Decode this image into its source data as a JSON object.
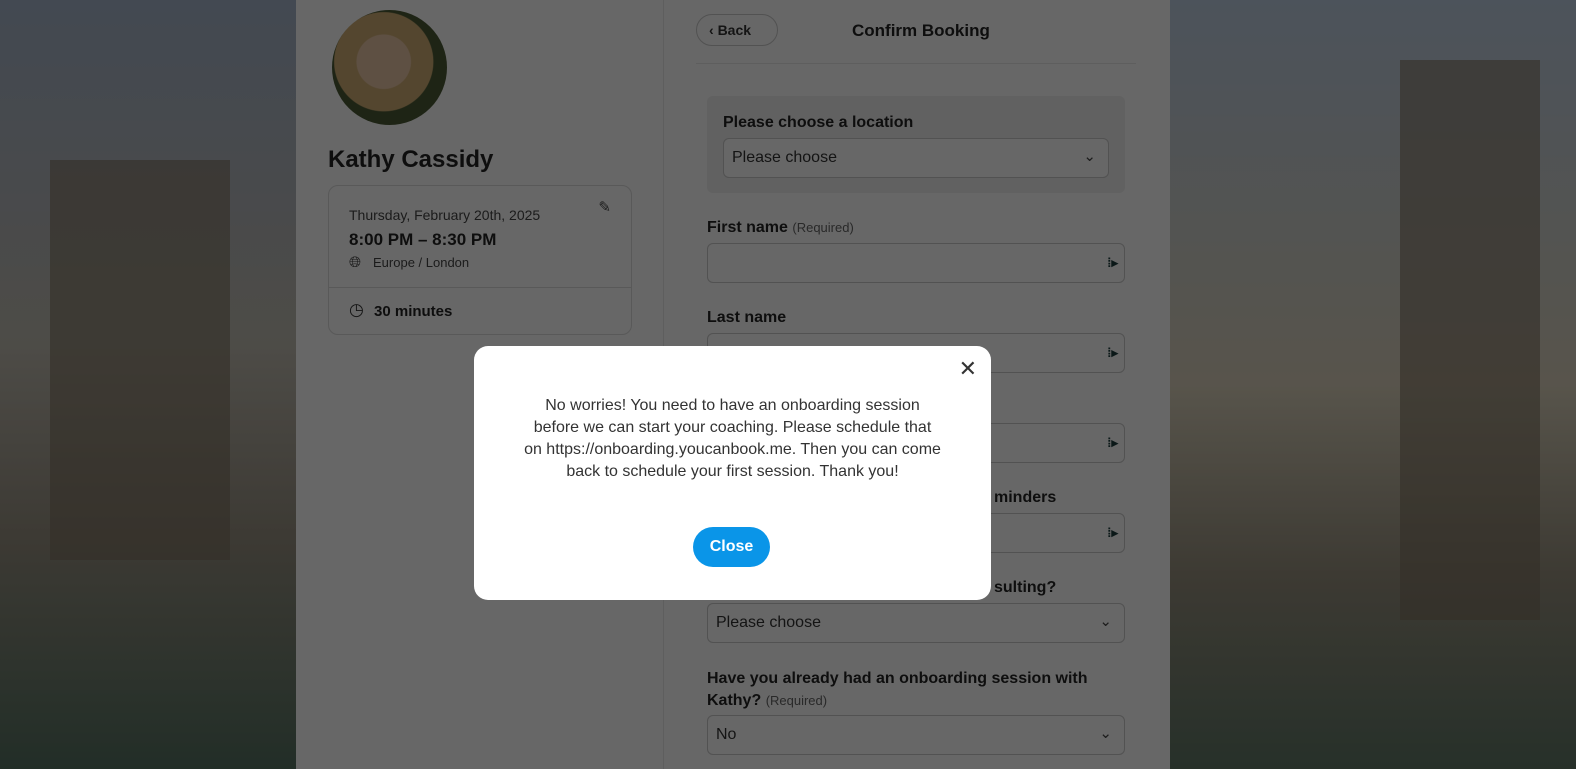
{
  "host": {
    "name": "Kathy Cassidy"
  },
  "booking": {
    "date": "Thursday, February 20th, 2025",
    "time": "8:00 PM – 8:30 PM",
    "timezone": "Europe / London",
    "duration": "30 minutes"
  },
  "header": {
    "back_label": "Back",
    "title": "Confirm Booking"
  },
  "form": {
    "location": {
      "label": "Please choose a location",
      "value": "Please choose"
    },
    "first_name": {
      "label": "First name",
      "required": "(Required)"
    },
    "last_name": {
      "label": "Last name"
    },
    "reminders_label_fragment": "minders",
    "consulting": {
      "label_fragment": "sulting?",
      "value": "Please choose"
    },
    "onboarding": {
      "label": "Have you already had an onboarding session with Kathy?",
      "required": "(Required)",
      "value": "No"
    }
  },
  "modal": {
    "message": "No worries! You need to have an onboarding session before we can start your coaching. Please schedule that on https://onboarding.youcanbook.me. Then you can come back to schedule your first session. Thank you!",
    "close_label": "Close"
  },
  "colors": {
    "primary": "#0a95e8"
  }
}
